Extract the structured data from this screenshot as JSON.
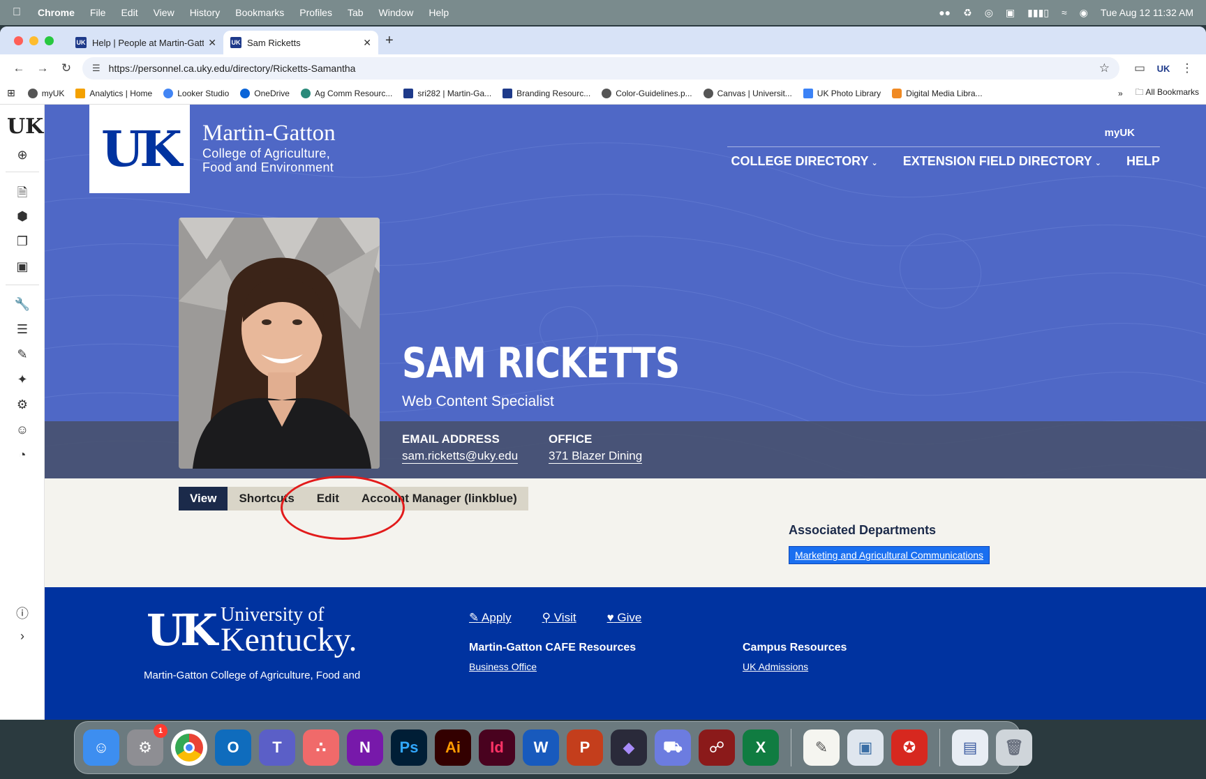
{
  "menubar": {
    "app": "Chrome",
    "items": [
      "File",
      "Edit",
      "View",
      "History",
      "Bookmarks",
      "Profiles",
      "Tab",
      "Window",
      "Help"
    ],
    "clock": "Tue Aug 12  11:32 AM"
  },
  "tabs": [
    {
      "title": "Help | People at Martin-Gatto",
      "active": false
    },
    {
      "title": "Sam Ricketts",
      "active": true
    }
  ],
  "address": {
    "url": "https://personnel.ca.uky.edu/directory/Ricketts-Samantha"
  },
  "bookmarks": [
    {
      "label": "myUK",
      "color": "#555555"
    },
    {
      "label": "Analytics | Home",
      "color": "#f4a100"
    },
    {
      "label": "Looker Studio",
      "color": "#4285f4"
    },
    {
      "label": "OneDrive",
      "color": "#0a64d8"
    },
    {
      "label": "Ag Comm Resourc...",
      "color": "#2a8a7a"
    },
    {
      "label": "sri282 | Martin-Ga...",
      "color": "#1e3a8a"
    },
    {
      "label": "Branding Resourc...",
      "color": "#1e3a8a"
    },
    {
      "label": "Color-Guidelines.p...",
      "color": "#555555"
    },
    {
      "label": "Canvas | Universit...",
      "color": "#555555"
    },
    {
      "label": "UK Photo Library",
      "color": "#3b82f6"
    },
    {
      "label": "Digital Media Libra...",
      "color": "#f08a24"
    }
  ],
  "bookmarks_all": "All Bookmarks",
  "site": {
    "brand_line1": "Martin-Gatton",
    "brand_line2": "College of Agriculture,",
    "brand_line3": "Food and Environment",
    "myuk": "myUK",
    "nav": [
      "COLLEGE DIRECTORY",
      "EXTENSION FIELD DIRECTORY",
      "HELP"
    ]
  },
  "profile": {
    "name": "SAM RICKETTS",
    "title": "Web Content Specialist",
    "email_label": "EMAIL ADDRESS",
    "email": "sam.ricketts@uky.edu",
    "office_label": "OFFICE",
    "office": "371 Blazer Dining"
  },
  "profile_tabs": [
    {
      "label": "View",
      "active": true
    },
    {
      "label": "Shortcuts",
      "active": false
    },
    {
      "label": "Edit",
      "active": false
    },
    {
      "label": "Account Manager (linkblue)",
      "active": false
    }
  ],
  "associated": {
    "heading": "Associated Departments",
    "department": "Marketing and Agricultural Communications"
  },
  "footer": {
    "uni_line1": "University of",
    "uni_line2": "Kentucky.",
    "sub": "Martin-Gatton College of Agriculture, Food and",
    "links": [
      "Apply",
      "Visit",
      "Give"
    ],
    "col1_heading": "Martin-Gatton CAFE Resources",
    "col1_link": "Business Office",
    "col2_heading": "Campus Resources",
    "col2_link": "UK Admissions"
  },
  "colors": {
    "hero_blue": "#4f68c6",
    "footer_blue": "#0033a0",
    "active_tab": "#1b2a4a",
    "annotation": "#e21b1b"
  }
}
